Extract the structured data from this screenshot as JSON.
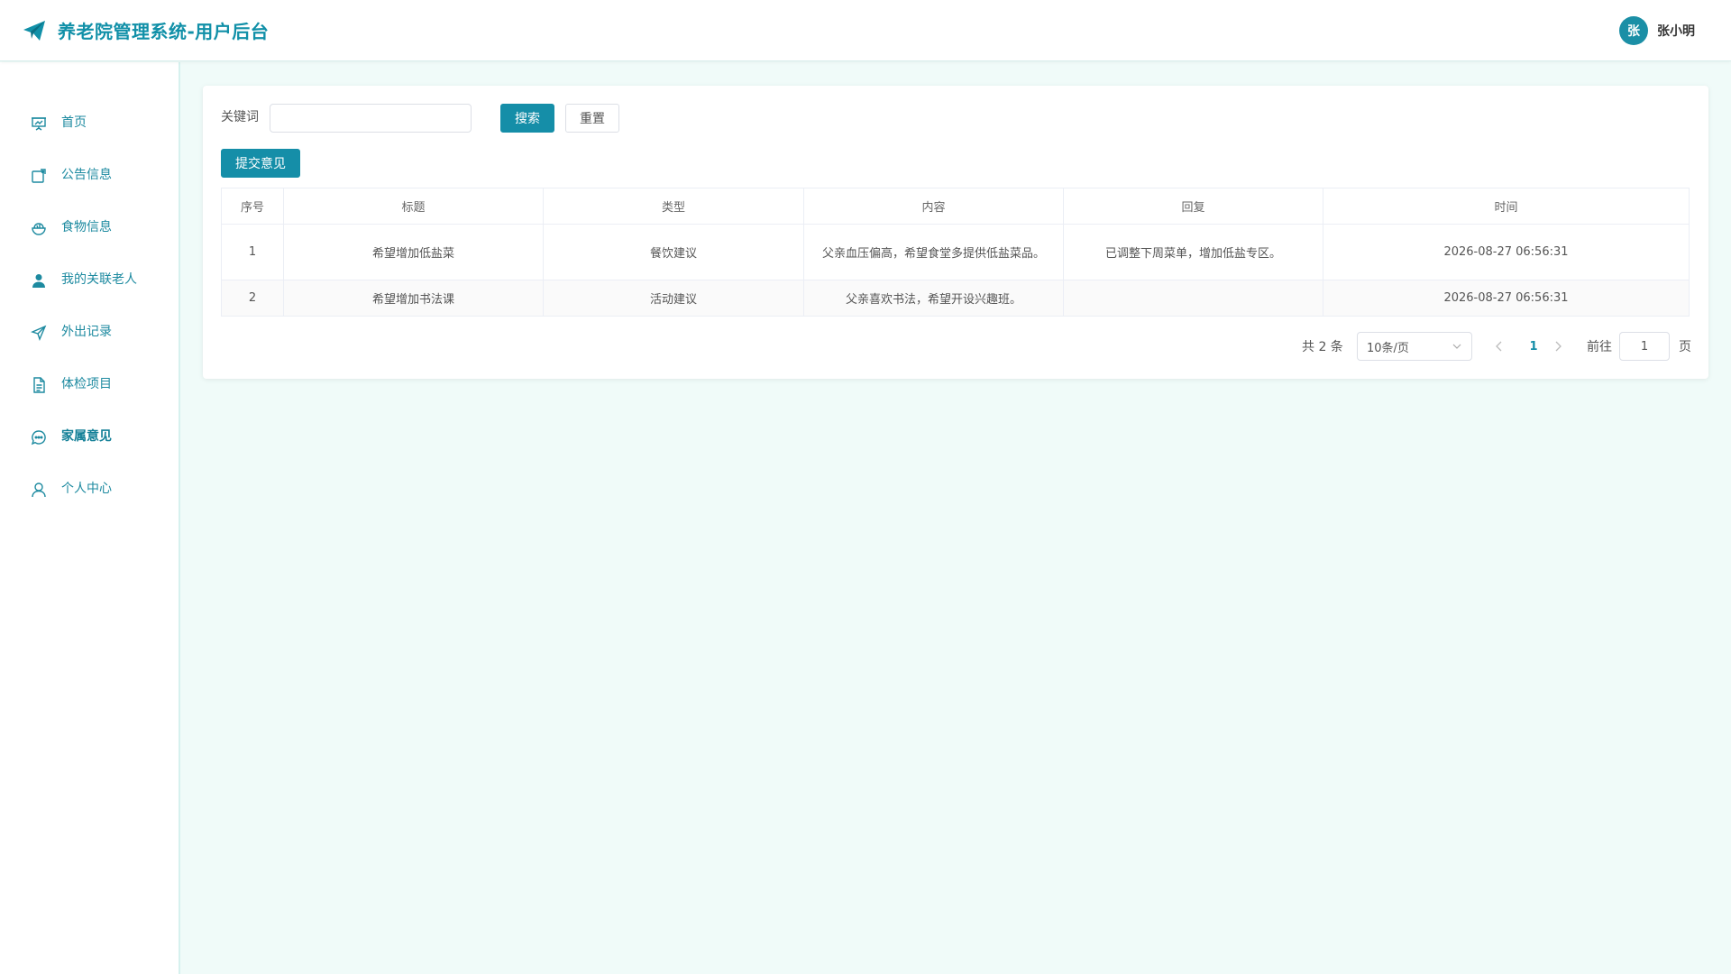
{
  "header": {
    "title": "养老院管理系统-用户后台",
    "user": {
      "avatar_text": "张",
      "name": "张小明"
    }
  },
  "sidebar": {
    "items": [
      {
        "label": "首页",
        "icon": "presentation-icon"
      },
      {
        "label": "公告信息",
        "icon": "notice-icon"
      },
      {
        "label": "食物信息",
        "icon": "food-bowl-icon"
      },
      {
        "label": "我的关联老人",
        "icon": "user-filled-icon"
      },
      {
        "label": "外出记录",
        "icon": "send-icon"
      },
      {
        "label": "体检项目",
        "icon": "document-icon"
      },
      {
        "label": "家属意见",
        "icon": "chat-bubble-icon",
        "active": true
      },
      {
        "label": "个人中心",
        "icon": "user-outline-icon"
      }
    ]
  },
  "search": {
    "label": "关键词",
    "value": "",
    "placeholder": "",
    "search_button": "搜索",
    "reset_button": "重置"
  },
  "actions": {
    "submit_label": "提交意见"
  },
  "table": {
    "columns": [
      "序号",
      "标题",
      "类型",
      "内容",
      "回复",
      "时间"
    ],
    "rows": [
      [
        "1",
        "希望增加低盐菜",
        "餐饮建议",
        "父亲血压偏高，希望食堂多提供低盐菜品。",
        "已调整下周菜单，增加低盐专区。",
        "2026-08-27 06:56:31"
      ],
      [
        "2",
        "希望增加书法课",
        "活动建议",
        "父亲喜欢书法，希望开设兴趣班。",
        "",
        "2026-08-27 06:56:31"
      ]
    ]
  },
  "pagination": {
    "total_text": "共 2 条",
    "page_size": "10条/页",
    "current_page": "1",
    "goto_label": "前往",
    "goto_value": "1",
    "page_suffix": "页"
  },
  "colors": {
    "accent": "#158ea8",
    "background": "#f0fbf9",
    "sidebar_text": "#1d8aa0"
  }
}
